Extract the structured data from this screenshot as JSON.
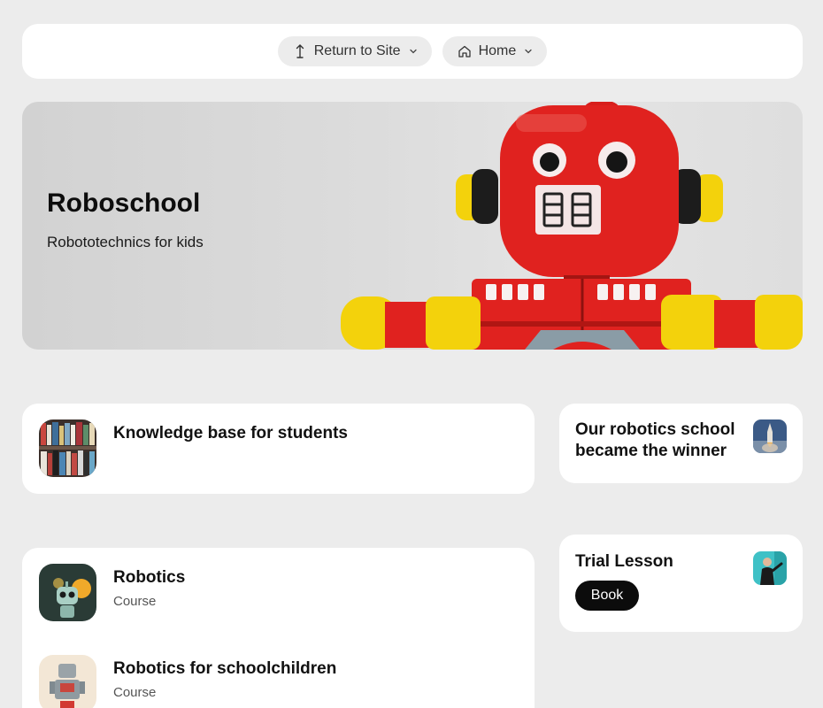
{
  "nav": {
    "return_label": "Return to Site",
    "home_label": "Home"
  },
  "hero": {
    "title": "Roboschool",
    "subtitle": "Robototechnics for kids"
  },
  "cards": {
    "knowledge": {
      "title": "Knowledge base for students"
    },
    "news": {
      "title_line1": "Our robotics school",
      "title_line2": "became the winner"
    },
    "trial": {
      "title": "Trial Lesson",
      "button_label": "Book"
    },
    "courses": [
      {
        "title": "Robotics",
        "meta": "Course"
      },
      {
        "title": "Robotics for schoolchildren",
        "meta": "Course"
      }
    ]
  },
  "icons": {
    "return": "arrow-up-icon",
    "home": "home-icon",
    "chevron": "chevron-down-icon"
  },
  "colors": {
    "background": "#ececec",
    "card": "#ffffff",
    "button": "#0c0c0c",
    "robot_red": "#e0221f",
    "robot_yellow": "#f5d90a"
  }
}
